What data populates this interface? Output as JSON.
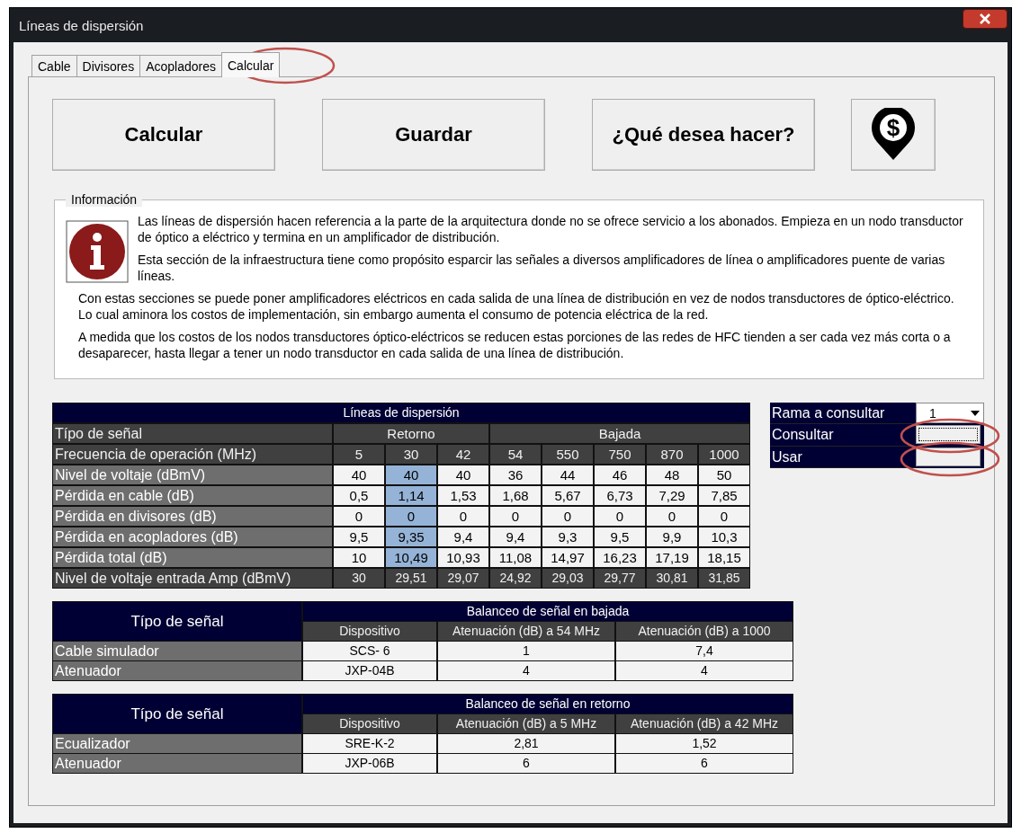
{
  "window": {
    "title": "Líneas de dispersión"
  },
  "tabs": [
    {
      "label": "Cable",
      "selected": false
    },
    {
      "label": "Divisores",
      "selected": false
    },
    {
      "label": "Acopladores",
      "selected": false
    },
    {
      "label": "Calcular",
      "selected": true
    }
  ],
  "buttons": [
    {
      "kind": "text",
      "label": "Calcular"
    },
    {
      "kind": "text",
      "label": "Guardar"
    },
    {
      "kind": "text",
      "label": "¿Qué desea hacer?"
    },
    {
      "kind": "icon",
      "label": "$"
    }
  ],
  "info": {
    "legend": "Información",
    "paragraphs": [
      "Las líneas de dispersión hacen referencia a la parte de la arquitectura donde no se ofrece servicio a los  abonados. Empieza en un nodo transductor de óptico a eléctrico y termina en un amplificador de distribución.",
      "Esta sección de la infraestructura tiene como propósito esparcir las señales a diversos amplificadores  de línea o  amplificadores puente de varias líneas.",
      "Con estas secciones se puede poner amplificadores eléctricos en cada salida de una línea de distribución en vez de nodos transductores de óptico-eléctrico. Lo cual aminora los costos de implementación, sin embargo aumenta el consumo de potencia eléctrica de la red.",
      "A medida que los costos de los nodos transductores óptico-eléctricos se reducen estas porciones de las redes de HFC  tienden a ser cada vez más corta o a desaparecer, hasta llegar a tener un nodo transductor en cada salida de una línea de distribución."
    ]
  },
  "dispersion_table": {
    "title": "Líneas de dispersión",
    "group_label": "Típo de señal",
    "groups": [
      {
        "label": "Retorno",
        "columns": [
          {
            "label": "5",
            "selected": false
          },
          {
            "label": "30",
            "selected": true
          },
          {
            "label": "42",
            "selected": false
          }
        ]
      },
      {
        "label": "Bajada",
        "columns": [
          {
            "label": "54",
            "selected": false
          },
          {
            "label": "550",
            "selected": false
          },
          {
            "label": "750",
            "selected": false
          },
          {
            "label": "870",
            "selected": false
          },
          {
            "label": "1000",
            "selected": false
          }
        ]
      }
    ],
    "frequency_label": "Frecuencia de operación (MHz)",
    "rows": [
      {
        "kind": "value",
        "label": "Nivel de voltaje (dBmV)",
        "values": [
          "40",
          "40",
          "40",
          "36",
          "44",
          "46",
          "48",
          "50"
        ]
      },
      {
        "kind": "value",
        "label": "Pérdida en cable  (dB)",
        "values": [
          "0,5",
          "1,14",
          "1,53",
          "1,68",
          "5,67",
          "6,73",
          "7,29",
          "7,85"
        ]
      },
      {
        "kind": "value",
        "label": "Pérdida en divisores (dB)",
        "values": [
          "0",
          "0",
          "0",
          "0",
          "0",
          "0",
          "0",
          "0"
        ]
      },
      {
        "kind": "value",
        "label": "Pérdida en acopladores (dB)",
        "values": [
          "9,5",
          "9,35",
          "9,4",
          "9,4",
          "9,3",
          "9,5",
          "9,9",
          "10,3"
        ]
      },
      {
        "kind": "value",
        "label": "Pérdida total (dB)",
        "values": [
          "10",
          "10,49",
          "10,93",
          "11,08",
          "14,97",
          "16,23",
          "17,19",
          "18,15"
        ]
      },
      {
        "kind": "result",
        "label": "Nivel de voltaje entrada Amp (dBmV)",
        "values": [
          "30",
          "29,51",
          "29,07",
          "24,92",
          "29,03",
          "29,77",
          "30,81",
          "31,85"
        ]
      }
    ]
  },
  "branch_panel": {
    "select_label": "Rama a consultar",
    "select_value": "1",
    "actions": [
      {
        "label": "Consultar",
        "focused": true
      },
      {
        "label": "Usar",
        "focused": false
      }
    ]
  },
  "balance_tables": [
    {
      "row_header": "Típo de señal",
      "title": "Balanceo de señal en bajada",
      "columns": [
        "Dispositivo",
        "Atenuación (dB) a 54 MHz",
        "Atenuación (dB) a 1000"
      ],
      "rows": [
        {
          "label": "Cable simulador",
          "values": [
            "SCS- 6",
            "1",
            "7,4"
          ]
        },
        {
          "label": "Atenuador",
          "values": [
            "JXP-04B",
            "4",
            "4"
          ]
        }
      ]
    },
    {
      "row_header": "Típo de señal",
      "title": "Balanceo de señal en retorno",
      "columns": [
        "Dispositivo",
        "Atenuación (dB) a 5 MHz",
        "Atenuación (dB) a 42 MHz"
      ],
      "rows": [
        {
          "label": "Ecualizador",
          "values": [
            "SRE-K-2",
            "2,81",
            "1,52"
          ]
        },
        {
          "label": "Atenuador",
          "values": [
            "JXP-06B",
            "6",
            "6"
          ]
        }
      ]
    }
  ]
}
